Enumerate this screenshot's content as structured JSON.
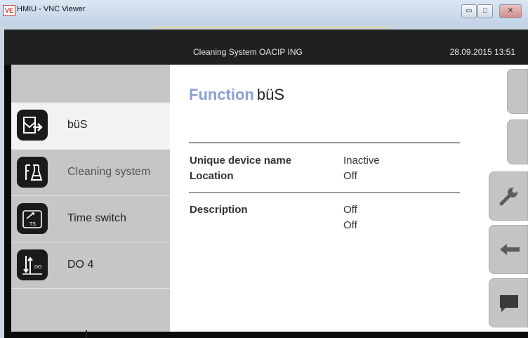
{
  "window": {
    "title": "HMIU - VNC Viewer",
    "logo": "VE"
  },
  "header": {
    "system": "Cleaning System  OACIP ING",
    "datetime": "28.09.2015  13:51"
  },
  "sidebar": {
    "items": [
      {
        "label": "büS",
        "icon": "bus-transfer-icon",
        "active": true
      },
      {
        "label": "Cleaning system",
        "icon": "flask-icon"
      },
      {
        "label": "Time switch",
        "icon": "time-switch-icon",
        "icon_text": "TS"
      },
      {
        "label": "DO 4",
        "icon": "digital-output-icon",
        "icon_text": "DO"
      }
    ]
  },
  "main": {
    "title_keyword": "Function",
    "title_name": "büS",
    "rows": [
      {
        "label": "Unique device name",
        "value": "Inactive"
      },
      {
        "label": "Location",
        "value": "Off"
      },
      {
        "label": "Description",
        "value": "Off"
      },
      {
        "label": "",
        "value": "Off"
      }
    ]
  },
  "right_buttons": [
    "blank-tab",
    "blank-tab",
    "wrench-icon",
    "back-arrow-icon",
    "chat-icon"
  ]
}
